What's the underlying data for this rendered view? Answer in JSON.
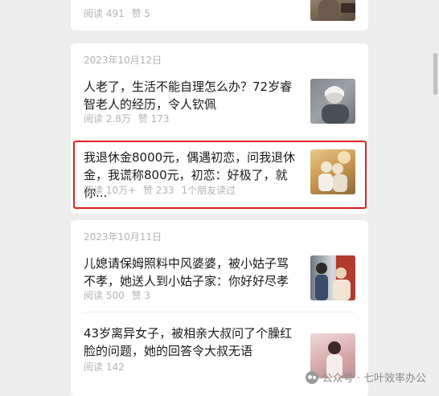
{
  "cards": [
    {
      "date": "",
      "articles": [
        {
          "title": "",
          "reads": "阅读 491",
          "likes": "赞 5",
          "friends": ""
        }
      ]
    },
    {
      "date": "2023年10月12日",
      "articles": [
        {
          "title": "人老了，生活不能自理怎么办？72岁睿智老人的经历，令人钦佩",
          "reads": "阅读 2.8万",
          "likes": "赞 173",
          "friends": ""
        },
        {
          "title": "我退休金8000元，偶遇初恋，问我退休金，我谎称800元，初恋：好极了，就你...",
          "reads": "阅读 10万+",
          "likes": "赞 233",
          "friends": "1个朋友读过"
        }
      ]
    },
    {
      "date": "2023年10月11日",
      "articles": [
        {
          "title": "儿媳请保姆照料中风婆婆，被小姑子骂不孝，她送人到小姑子家：你好好尽孝",
          "reads": "阅读 500",
          "likes": "赞 3",
          "friends": ""
        },
        {
          "title": "43岁离异女子，被相亲大叔问了个臊红脸的问题，她的回答令大叔无语",
          "reads": "阅读 142",
          "likes": "",
          "friends": ""
        }
      ]
    }
  ],
  "watermark": {
    "text": "公众号 · 七叶效率办公"
  },
  "colors": {
    "highlight": "#e02020",
    "background": "#ededed",
    "card": "#ffffff"
  }
}
